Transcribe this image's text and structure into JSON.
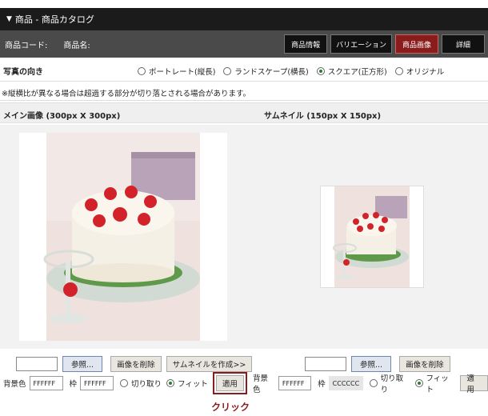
{
  "title": "商品 - 商品カタログ",
  "info": {
    "product_code_label": "商品コード:",
    "product_name_label": "商品名:"
  },
  "tabs": [
    "商品情報",
    "バリエーション",
    "商品画像",
    "詳細"
  ],
  "active_tab_index": 2,
  "orientation": {
    "label": "写真の向き",
    "options": [
      "ポートレート(縦長)",
      "ランドスケープ(横長)",
      "スクエア(正方形)",
      "オリジナル"
    ],
    "selected_index": 2
  },
  "note": "※縦横比が異なる場合は超過する部分が切り落とされる場合があります。",
  "main_image": {
    "heading": "メイン画像 (300px X 300px)",
    "browse_label": "参照...",
    "delete_label": "画像を削除",
    "make_thumb_label": "サムネイルを作成>>",
    "bg_label": "背景色",
    "bg_value": "FFFFFF",
    "frame_label": "枠",
    "frame_value": "FFFFFF",
    "crop_label": "切り取り",
    "fit_label": "フィット",
    "fit_selected": true,
    "apply_label": "適用"
  },
  "thumbnail": {
    "heading": "サムネイル (150px X 150px)",
    "browse_label": "参照...",
    "delete_label": "画像を削除",
    "bg_label": "背景色",
    "bg_value": "FFFFFF",
    "frame_label": "枠",
    "frame_value": "CCCCCC",
    "crop_label": "切り取り",
    "fit_label": "フィット",
    "fit_selected": true,
    "apply_label": "適用"
  },
  "annotation": "クリック",
  "colors": {
    "titlebar": "#1b1b1b",
    "infobar": "#4a4a4a",
    "active_tab": "#8a1c1c",
    "radio_on": "#2a7f2a"
  }
}
